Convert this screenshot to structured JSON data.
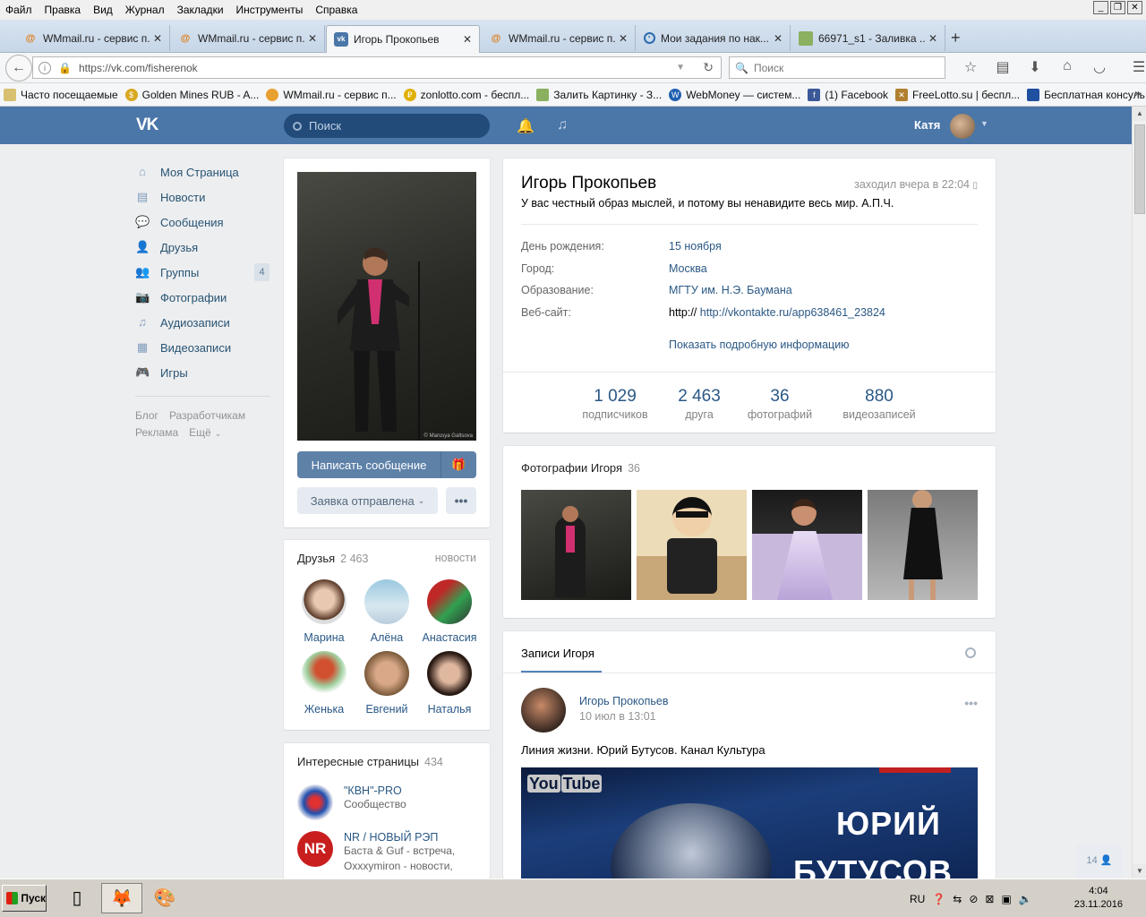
{
  "browser": {
    "menu": [
      "Файл",
      "Правка",
      "Вид",
      "Журнал",
      "Закладки",
      "Инструменты",
      "Справка"
    ],
    "tabs": [
      {
        "label": "WMmail.ru - сервис п...",
        "icon": "wmmail-icon"
      },
      {
        "label": "WMmail.ru - сервис п...",
        "icon": "wmmail-icon"
      },
      {
        "label": "Игорь Прокопьев",
        "icon": "vk-icon"
      },
      {
        "label": "WMmail.ru - сервис п...",
        "icon": "wmmail-icon"
      },
      {
        "label": "Мои задания по нак...",
        "icon": "target-icon"
      },
      {
        "label": "66971_s1 - Заливка ...",
        "icon": "image-icon"
      }
    ],
    "url": "https://vk.com/fisherenok",
    "search_placeholder": "Поиск",
    "bookmarks": [
      "Часто посещаемые",
      "Golden Mines RUB - A...",
      "WMmail.ru - сервис п...",
      "zonlotto.com - беспл...",
      "Залить Картинку - З...",
      "WebMoney — систем...",
      "(1) Facebook",
      "FreeLotto.su | беспл...",
      "Бесплатная консуль..."
    ]
  },
  "vk": {
    "search_placeholder": "Поиск",
    "user_name": "Катя",
    "nav": [
      {
        "label": "Моя Страница",
        "icon": "home-icon"
      },
      {
        "label": "Новости",
        "icon": "news-icon"
      },
      {
        "label": "Сообщения",
        "icon": "messages-icon"
      },
      {
        "label": "Друзья",
        "icon": "friends-icon"
      },
      {
        "label": "Группы",
        "icon": "groups-icon",
        "badge": "4"
      },
      {
        "label": "Фотографии",
        "icon": "camera-icon"
      },
      {
        "label": "Аудиозаписи",
        "icon": "music-icon"
      },
      {
        "label": "Видеозаписи",
        "icon": "video-icon"
      },
      {
        "label": "Игры",
        "icon": "gamepad-icon"
      }
    ],
    "footer_links": [
      "Блог",
      "Разработчикам",
      "Реклама",
      "Ещё"
    ],
    "profile": {
      "name": "Игорь Прокопьев",
      "online": "заходил вчера в 22:04",
      "status": "У вас честный образ мыслей, и потому вы ненавидите весь мир. А.П.Ч.",
      "info": [
        {
          "label": "День рождения:",
          "value": "15 ноября"
        },
        {
          "label": "Город:",
          "value": "Москва"
        },
        {
          "label": "Образование:",
          "value": "МГТУ им. Н.Э. Баумана"
        }
      ],
      "website_label": "Веб-сайт:",
      "website_prefix": "http://",
      "website": "http://vkontakte.ru/app638461_23824",
      "show_more": "Показать подробную информацию",
      "counters": [
        {
          "num": "1 029",
          "label": "подписчиков"
        },
        {
          "num": "2 463",
          "label": "друга"
        },
        {
          "num": "36",
          "label": "фотографий"
        },
        {
          "num": "880",
          "label": "видеозаписей"
        }
      ],
      "photo_watermark": "© Marusya Galtsova"
    },
    "actions": {
      "message": "Написать сообщение",
      "request": "Заявка отправлена",
      "more": "•••"
    },
    "friends": {
      "title": "Друзья",
      "count": "2 463",
      "news_link": "новости",
      "list": [
        "Марина",
        "Алёна",
        "Анастасия",
        "Женька",
        "Евгений",
        "Наталья"
      ]
    },
    "interesting": {
      "title": "Интересные страницы",
      "count": "434",
      "list": [
        {
          "name": "\"КВН\"-PRO",
          "desc": "Сообщество"
        },
        {
          "name": "NR / НОВЫЙ РЭП",
          "desc": "Баста & Guf - встреча, Oxxxymiron - новости,"
        }
      ]
    },
    "photos": {
      "title": "Фотографии Игоря",
      "count": "36"
    },
    "wall": {
      "tab": "Записи Игоря",
      "post_author": "Игорь Прокопьев",
      "post_date": "10 июл в 13:01",
      "post_text": "Линия жизни. Юрий Бутусов. Канал Культура",
      "video_brand": "You",
      "video_brand2": "Tube",
      "video_title1": "ЮРИЙ",
      "video_title2": "БУТУСОВ"
    },
    "float_count": "14"
  },
  "taskbar": {
    "start": "Пуск",
    "lang": "RU",
    "time": "4:04",
    "date": "23.11.2016"
  },
  "colors": {
    "vk_header": "#4a76a8",
    "vk_link": "#2a5885",
    "button_primary": "#5e81a8"
  }
}
